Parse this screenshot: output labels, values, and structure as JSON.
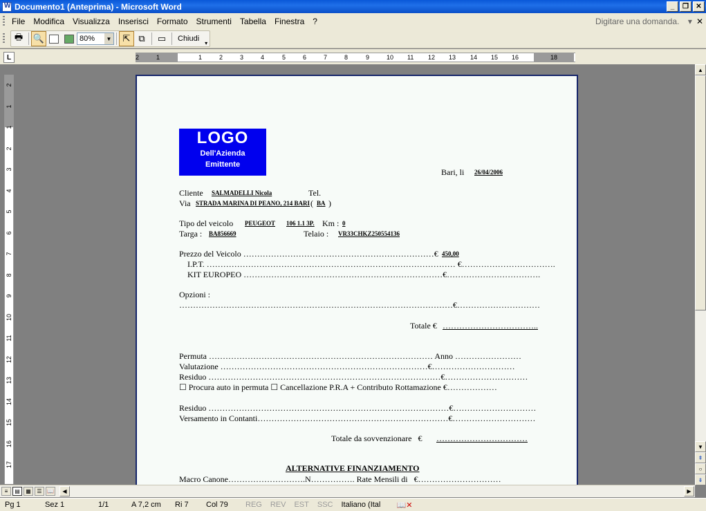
{
  "window": {
    "title": "Documento1 (Anteprima) - Microsoft Word"
  },
  "menu": {
    "items": [
      "File",
      "Modifica",
      "Visualizza",
      "Inserisci",
      "Formato",
      "Strumenti",
      "Tabella",
      "Finestra",
      "?"
    ],
    "ask": "Digitare una domanda."
  },
  "toolbar": {
    "zoom": "80%",
    "close": "Chiudi"
  },
  "ruler": {
    "h_numbers": [
      "2",
      "1",
      "1",
      "2",
      "3",
      "4",
      "5",
      "6",
      "7",
      "8",
      "9",
      "10",
      "11",
      "12",
      "13",
      "14",
      "15",
      "16",
      "18"
    ],
    "v_numbers": [
      "2",
      "1",
      "1",
      "2",
      "3",
      "4",
      "5",
      "6",
      "7",
      "8",
      "9",
      "10",
      "11",
      "12",
      "13",
      "14",
      "15",
      "16",
      "17"
    ]
  },
  "doc": {
    "logo": {
      "title": "LOGO",
      "line1": "Dell'Azienda",
      "line2": "Emittente"
    },
    "place": "Bari, li",
    "date": "26/04/2006",
    "cliente_label": "Cliente",
    "cliente": "SALMADELLI Nicola",
    "tel_label": "Tel.",
    "via_label": "Via",
    "via": "STRADA MARINA DI PEANO, 214 BARI",
    "prov_open": "(",
    "prov": "BA",
    "prov_close": ")",
    "tipo_label": "Tipo del veicolo",
    "tipo": "PEUGEOT",
    "modello": "106 1.1 3P.",
    "km_label": "Km :",
    "km": "0",
    "targa_label": "Targa :",
    "targa": "BA856669",
    "telaio_label": "Telaio :",
    "telaio": "VR33CHKZ250554136",
    "prezzo": "Prezzo del Veicolo ……………………………………………………………€",
    "prezzo_val": "450,00",
    "ipt": "I.P.T. ……………………………………………………………………………… €…………………………….",
    "kit": "KIT EUROPEO ………………………………………………………………€…………………………….",
    "opzioni": "Opzioni :",
    "opzioni_line": "………………………………………………………………………………………€…………………………",
    "totale_label": "Totale €",
    "totale_val": "……………………………..",
    "permuta": "Permuta ……………………………………………………………………… Anno ……………………",
    "valutazione": "Valutazione …………………………………………………………………€…………………………",
    "residuo1": "Residuo …………………………………………………………………………€…………………………",
    "procura": "☐ Procura auto in permuta ☐ Cancellazione P.R.A + Contributo Rottamazione €………………",
    "residuo2": "Residuo ……………………………………………………………………………€…………………………",
    "versamento": "Versamento in Contanti……………………………………………………………€…………………………",
    "sovv_label": "Totale da sovvenzionare   €",
    "sovv_val": "……………………………",
    "alt_title": "ALTERNATIVE FINANZIAMENTO",
    "macro": "Macro Canone……………………….N……………. Rate Mensili di   €…………………………"
  },
  "status": {
    "pg": "Pg 1",
    "sez": "Sez 1",
    "pages": "1/1",
    "at": "A 7,2 cm",
    "ri": "Ri 7",
    "col": "Col 79",
    "reg": "REG",
    "rev": "REV",
    "est": "EST",
    "ssc": "SSC",
    "lang": "Italiano (Ital"
  }
}
